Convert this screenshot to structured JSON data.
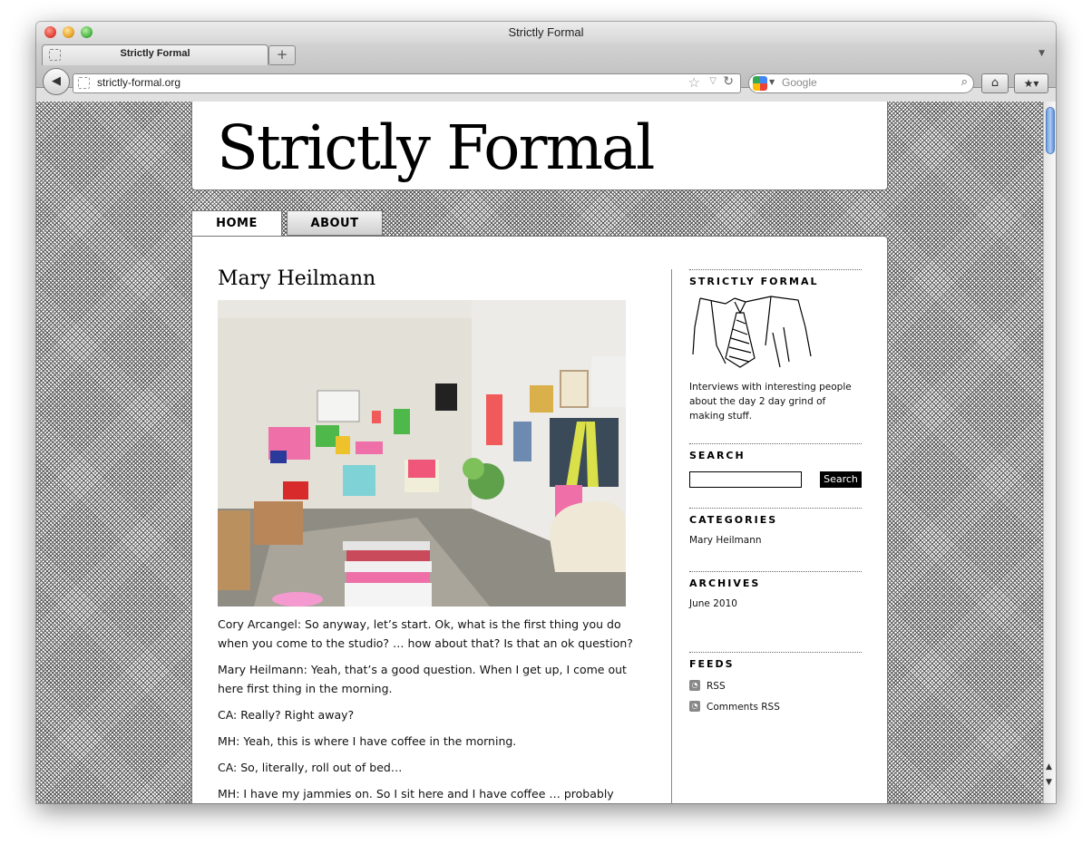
{
  "window": {
    "title": "Strictly Formal"
  },
  "tabs": [
    {
      "label": "Strictly Formal"
    }
  ],
  "toolbar": {
    "new_tab_label": "+",
    "url": "strictly-formal.org",
    "search_placeholder": "Google"
  },
  "site": {
    "title": "Strictly Formal",
    "nav": [
      {
        "label": "HOME"
      },
      {
        "label": "ABOUT"
      }
    ]
  },
  "post": {
    "title": "Mary Heilmann",
    "paragraphs": [
      "Cory Arcangel: So anyway, let’s start. Ok, what is the first thing you do when you come to the studio? … how about that? Is that an ok question?",
      "Mary Heilmann: Yeah, that’s a good question. When I get up, I come out here first thing in the morning.",
      "CA: Really? Right away?",
      "MH: Yeah, this is where I have coffee in the morning.",
      "CA: So, literally, roll out of bed…",
      "MH: I have my jammies on. So I sit here and I have coffee … probably"
    ]
  },
  "sidebar": {
    "about": {
      "heading": "STRICTLY FORMAL",
      "description": "Interviews with interesting people about the day 2 day grind of making stuff."
    },
    "search": {
      "heading": "SEARCH",
      "button_label": "Search"
    },
    "categories": {
      "heading": "CATEGORIES",
      "items": [
        "Mary Heilmann"
      ]
    },
    "archives": {
      "heading": "ARCHIVES",
      "items": [
        "June 2010"
      ]
    },
    "feeds": {
      "heading": "FEEDS",
      "items": [
        "RSS",
        "Comments RSS"
      ]
    }
  }
}
